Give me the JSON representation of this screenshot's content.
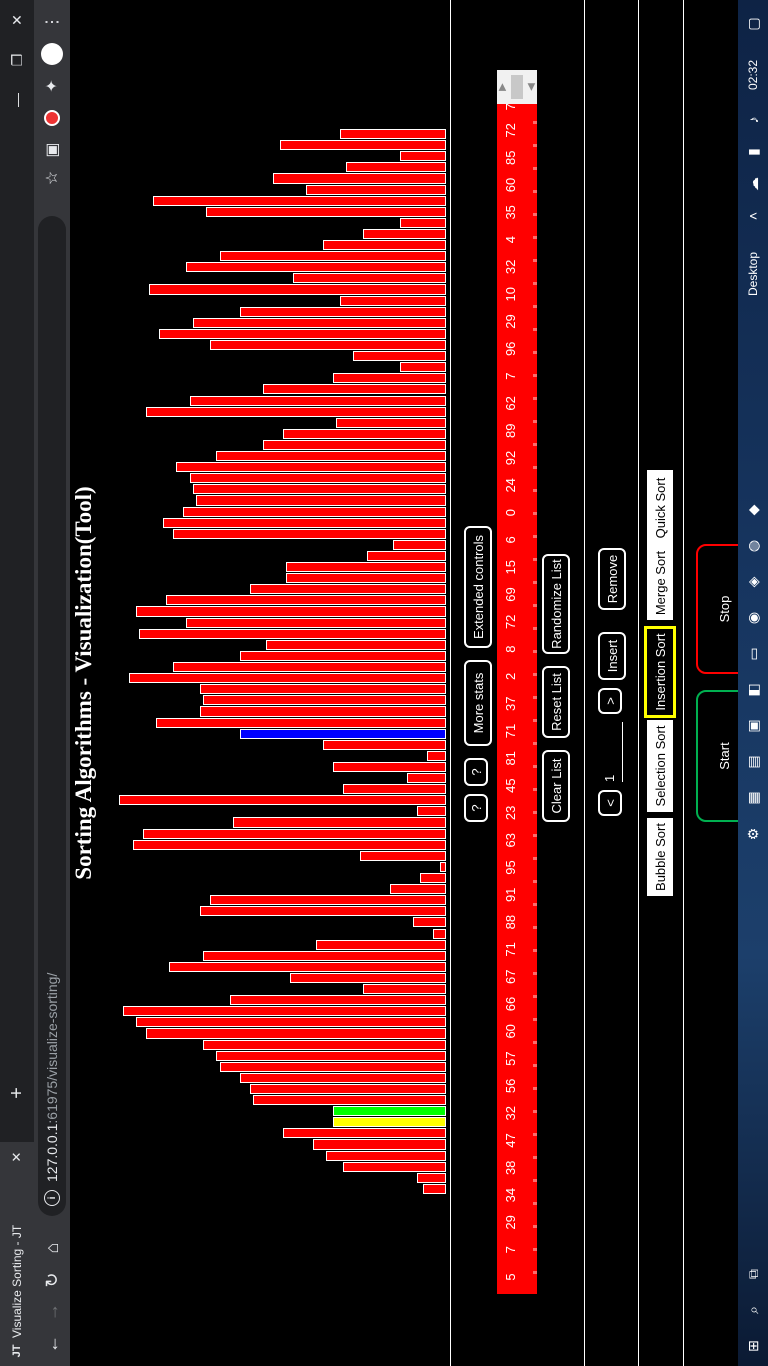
{
  "browser": {
    "tab_title": "Visualize Sorting - JT",
    "tab_icon": "JT-favicon",
    "address_host": "127.0.0.1",
    "address_path": ":61975/visualize-sorting/"
  },
  "page": {
    "title": "Sorting Algorithms - Visualization(Tool)"
  },
  "colors": {
    "bar_default": "#ff0000",
    "bar_compare": "#0000ff",
    "bar_swap": "#ffff00",
    "bar_sorted_marker": "#00ff00",
    "active_algorithm_border": "#ffff00",
    "start_border": "#00b050",
    "stop_border": "#ff0000"
  },
  "chart_data": {
    "type": "bar",
    "values": [
      5,
      7,
      29,
      34,
      38,
      47,
      32,
      32,
      56,
      57,
      60,
      66,
      67,
      71,
      88,
      91,
      95,
      63,
      23,
      45,
      81,
      71,
      37,
      2,
      8,
      72,
      69,
      15,
      6,
      0,
      24,
      92,
      89,
      62,
      7,
      96,
      29,
      10,
      32,
      4,
      35,
      60,
      85,
      72,
      71,
      72,
      93,
      80,
      60,
      52,
      90,
      76,
      91,
      82,
      57,
      46,
      46,
      22,
      14,
      80,
      83,
      77,
      73,
      74,
      75,
      79,
      67,
      53,
      47,
      31,
      88,
      75,
      53,
      32,
      12,
      26,
      69,
      84,
      74,
      60,
      30,
      87,
      44,
      76,
      66,
      35,
      23,
      12,
      70,
      86,
      40,
      50,
      28,
      12,
      48,
      30
    ],
    "highlight": {
      "compare": [
        41
      ],
      "swap": [
        6
      ],
      "sorted_marker": [
        7
      ]
    }
  },
  "controls": {
    "help_1": "?",
    "help_2": "?",
    "more_stats": "More stats",
    "extended_controls": "Extended controls",
    "clear_list": "Clear List",
    "reset_list": "Reset List",
    "randomize_list": "Randomize List",
    "prev": "<",
    "next": ">",
    "position_value": "1",
    "insert": "Insert",
    "remove": "Remove",
    "start": "Start",
    "stop": "Stop"
  },
  "algorithms": [
    "Bubble Sort",
    "Selection Sort",
    "Insertion Sort",
    "Merge Sort",
    "Quick Sort"
  ],
  "selected_algorithm": "Insertion Sort",
  "array_values": [
    5,
    7,
    29,
    34,
    38,
    47,
    32,
    56,
    57,
    60,
    66,
    67,
    71,
    88,
    91,
    95,
    63,
    23,
    45,
    81,
    71,
    37,
    2,
    8,
    72,
    69,
    15,
    6,
    0,
    24,
    92,
    89,
    62,
    7,
    96,
    29,
    10,
    32,
    4,
    35,
    60,
    85,
    72,
    71
  ],
  "chrome_icons": [
    "back-icon",
    "forward-icon",
    "reload-icon",
    "home-icon",
    "info-icon",
    "star-icon",
    "extension-icon",
    "pdf-icon",
    "puzzle-icon",
    "profile-icon",
    "menu-icon"
  ],
  "taskbar": {
    "desktop_label": "Desktop",
    "clock": "02:32"
  }
}
